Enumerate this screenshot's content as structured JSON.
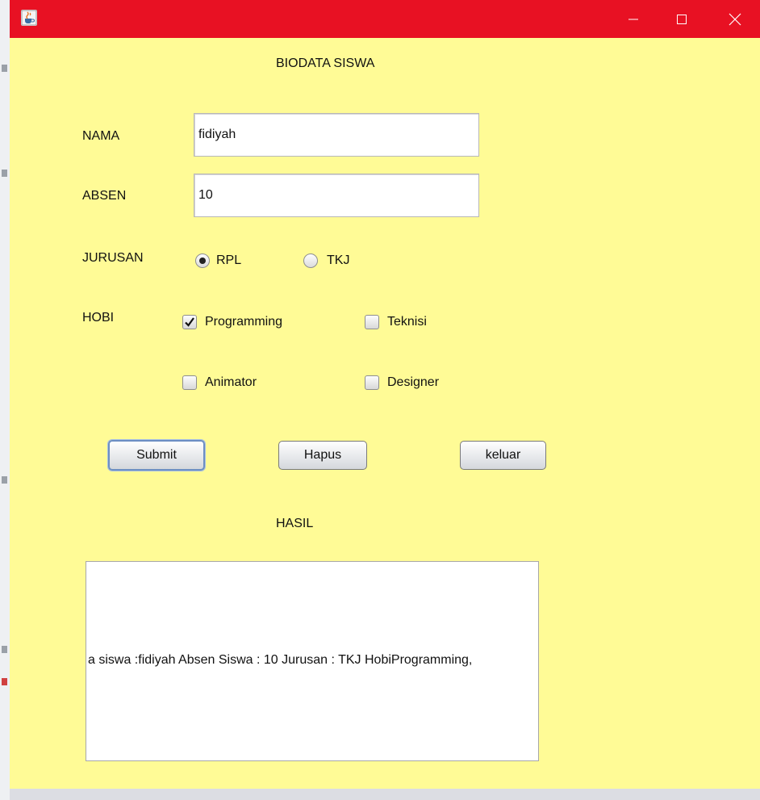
{
  "window": {
    "icon": "java-cup-icon"
  },
  "form": {
    "title": "BIODATA SISWA",
    "nama_label": "NAMA",
    "nama_value": "fidiyah",
    "absen_label": "ABSEN",
    "absen_value": "10",
    "jurusan_label": "JURUSAN",
    "jurusan_options": [
      {
        "label": "RPL",
        "selected": true
      },
      {
        "label": "TKJ",
        "selected": false
      }
    ],
    "hobi_label": "HOBI",
    "hobi_options": [
      {
        "label": "Programming",
        "checked": true
      },
      {
        "label": "Teknisi",
        "checked": false
      },
      {
        "label": "Animator",
        "checked": false
      },
      {
        "label": "Designer",
        "checked": false
      }
    ]
  },
  "buttons": {
    "submit": "Submit",
    "hapus": "Hapus",
    "keluar": "keluar"
  },
  "hasil": {
    "label": "HASIL",
    "text": "a siswa :fidiyah Absen Siswa : 10 Jurusan : TKJ HobiProgramming,"
  },
  "colors": {
    "titlebar": "#e81123",
    "window_bg": "#fffb96"
  }
}
